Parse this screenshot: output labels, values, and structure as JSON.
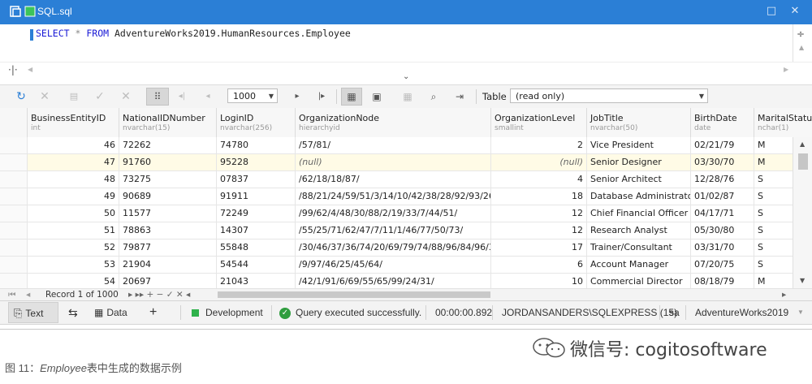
{
  "window": {
    "title": "SQL.sql",
    "min_glyph": "□",
    "close_glyph": "✕"
  },
  "editor": {
    "keyword_select": "SELECT",
    "star": "*",
    "keyword_from": "FROM",
    "table": "AdventureWorks2019.HumanResources.Employee"
  },
  "toolbar": {
    "page_size": "1000",
    "table_label": "Table",
    "view_mode": "(read only)"
  },
  "grid": {
    "columns": [
      {
        "name": "BusinessEntityID",
        "type": "int"
      },
      {
        "name": "NationalIDNumber",
        "type": "nvarchar(15)"
      },
      {
        "name": "LoginID",
        "type": "nvarchar(256)"
      },
      {
        "name": "OrganizationNode",
        "type": "hierarchyid"
      },
      {
        "name": "OrganizationLevel",
        "type": "smallint"
      },
      {
        "name": "JobTitle",
        "type": "nvarchar(50)"
      },
      {
        "name": "BirthDate",
        "type": "date"
      },
      {
        "name": "MaritalStatu",
        "type": "nchar(1)"
      }
    ],
    "rows": [
      [
        "46",
        "72262",
        "74780",
        "/57/81/",
        "2",
        "Vice President",
        "02/21/79",
        "M"
      ],
      [
        "47",
        "91760",
        "95228",
        "(null)",
        "(null)",
        "Senior Designer",
        "03/30/70",
        "M"
      ],
      [
        "48",
        "73275",
        "07837",
        "/62/18/18/87/",
        "4",
        "Senior Architect",
        "12/28/76",
        "S"
      ],
      [
        "49",
        "90689",
        "91911",
        "/88/21/24/59/51/3/14/10/42/38/28/92/93/26/...",
        "18",
        "Database Administrator",
        "01/02/87",
        "S"
      ],
      [
        "50",
        "11577",
        "72249",
        "/99/62/4/48/30/88/2/19/33/7/44/51/",
        "12",
        "Chief Financial Officer",
        "04/17/71",
        "S"
      ],
      [
        "51",
        "78863",
        "14307",
        "/55/25/71/62/47/7/11/1/46/77/50/73/",
        "12",
        "Research Analyst",
        "05/30/80",
        "S"
      ],
      [
        "52",
        "79877",
        "55848",
        "/30/46/37/36/74/20/69/79/74/88/96/84/96/3...",
        "17",
        "Trainer/Consultant",
        "03/31/70",
        "S"
      ],
      [
        "53",
        "21904",
        "54544",
        "/9/97/46/25/45/64/",
        "6",
        "Account Manager",
        "07/20/75",
        "S"
      ],
      [
        "54",
        "20697",
        "21043",
        "/42/1/91/6/69/55/65/99/24/31/",
        "10",
        "Commercial Director",
        "08/18/79",
        "M"
      ]
    ]
  },
  "navigator": {
    "first": "⏮",
    "prev": "◂",
    "record_text": "Record 1 of 1000",
    "controls": "▸ ▸▸ + − ✓ ✕ ◂",
    "right_arrow": "▸"
  },
  "statusbar": {
    "text_tab": "Text",
    "data_tab": "Data",
    "add": "+",
    "connection": "Development",
    "message": "Query executed successfully.",
    "elapsed": "00:00:00.892",
    "server": "JORDANSANDERS\\SQLEXPRESS (15)",
    "user": "sa",
    "database": "AdventureWorks2019"
  },
  "caption": {
    "prefix": "图 11：",
    "emphasis": "Employee",
    "suffix": "表中生成的数据示例"
  },
  "watermark": {
    "text": "微信号: cogitosoftware"
  },
  "colors": {
    "titlebar": "#2b7fd6",
    "null_row": "#fffbe6",
    "status_green": "#2fb24b"
  }
}
